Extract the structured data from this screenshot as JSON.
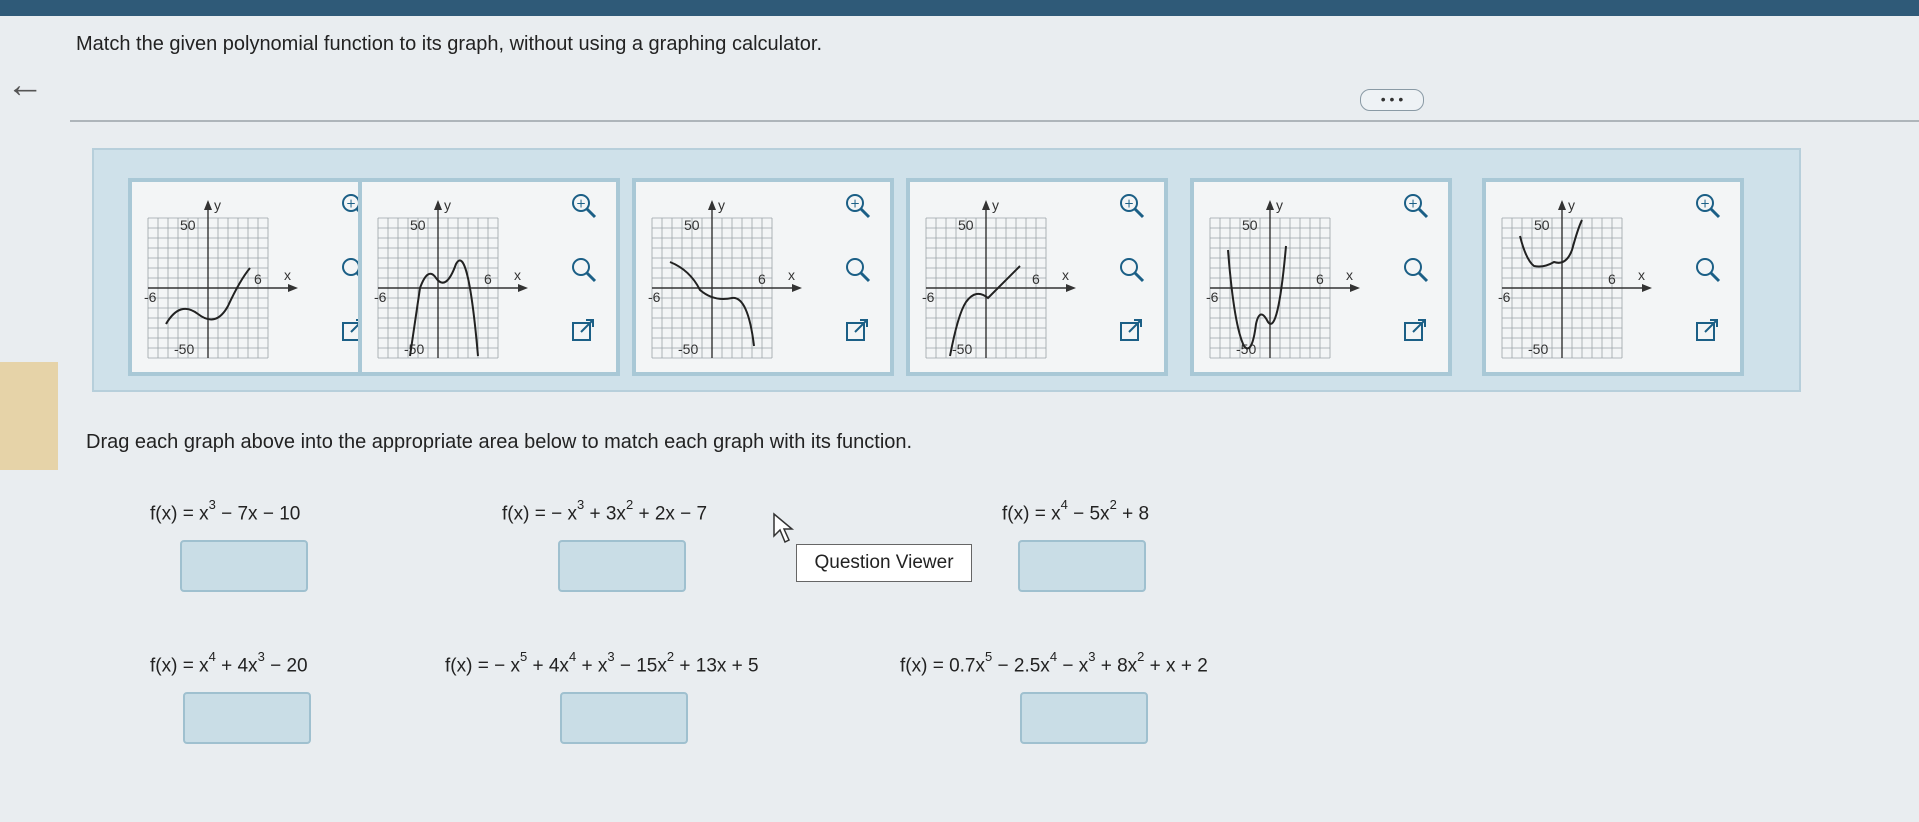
{
  "header": {
    "instruction": "Match the given polynomial function to its graph, without using a graphing calculator.",
    "more_label": "• • •"
  },
  "drag_instruction": "Drag each graph above into the appropriate area below to match each graph with its function.",
  "tooltip": "Question Viewer",
  "graph_labels": {
    "y": "y",
    "x": "x",
    "ymax": "50",
    "ymin": "-50",
    "xmin": "-6",
    "xmax": "6"
  },
  "functions": [
    {
      "parts": [
        "f(x) = x",
        "3",
        " − 7x − 10"
      ]
    },
    {
      "parts": [
        "f(x) = − x",
        "3",
        " + 3x",
        "2",
        " + 2x − 7"
      ]
    },
    {
      "parts": [
        "f(x) = x",
        "4",
        " − 5x",
        "2",
        " + 8"
      ]
    },
    {
      "parts": [
        "f(x) = x",
        "4",
        " + 4x",
        "3",
        " − 20"
      ]
    },
    {
      "parts": [
        "f(x) = − x",
        "5",
        " + 4x",
        "4",
        " + x",
        "3",
        " − 15x",
        "2",
        " + 13x + 5"
      ]
    },
    {
      "parts": [
        "f(x) = 0.7x",
        "5",
        " − 2.5x",
        "4",
        " − x",
        "3",
        " + 8x",
        "2",
        " + x + 2"
      ]
    }
  ],
  "icons": {
    "zoom_in": "zoom-in-icon",
    "zoom_out": "zoom-out-icon",
    "open": "open-external-icon",
    "back": "back-arrow-icon",
    "cursor": "mouse-cursor-icon"
  }
}
